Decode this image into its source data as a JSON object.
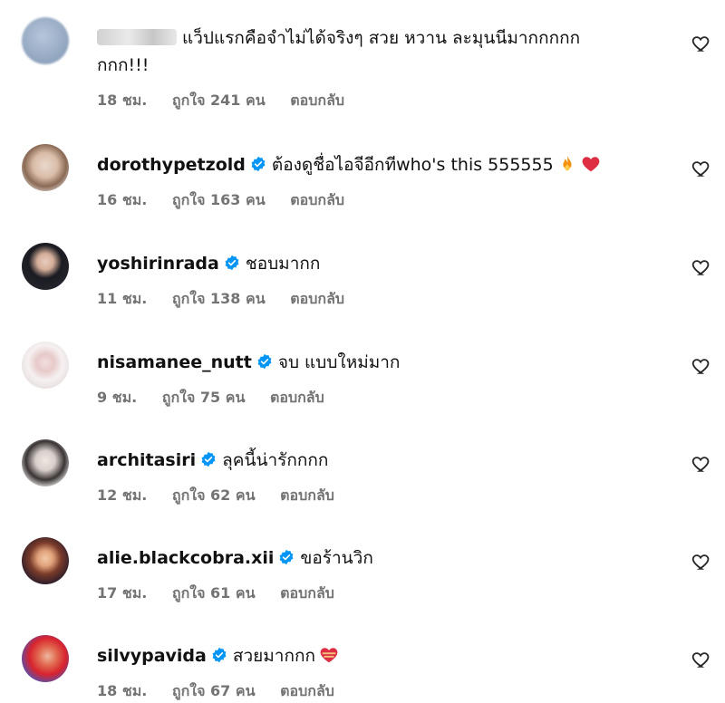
{
  "comments": [
    {
      "username": "",
      "text": "แว็ปแรกคือจำไม่ได้จริงๆ สวย หวาน ละมุนนีมากกกกก กกก!!!",
      "text_line1": "แว็ปแรกคือจำไม่ได้จริงๆ สวย หวาน ละมุนนีมากกกกก",
      "text_line2": "กกก!!!",
      "time": "18 ชม.",
      "likes": "ถูกใจ 241 คน",
      "reply": "ตอบกลับ"
    },
    {
      "username": "dorothypetzold",
      "text": "ต้องดูชื่อไอจีอีกทีwho's this 555555",
      "time": "16 ชม.",
      "likes": "ถูกใจ 163 คน",
      "reply": "ตอบกลับ"
    },
    {
      "username": "yoshirinrada",
      "text": "ชอบมากก",
      "time": "11 ชม.",
      "likes": "ถูกใจ 138 คน",
      "reply": "ตอบกลับ"
    },
    {
      "username": "nisamanee_nutt",
      "text": "จบ แบบใหม่มาก",
      "time": "9 ชม.",
      "likes": "ถูกใจ 75 คน",
      "reply": "ตอบกลับ"
    },
    {
      "username": "architasiri",
      "text": "ลุคนี้น่ารักกกก",
      "time": "12 ชม.",
      "likes": "ถูกใจ 62 คน",
      "reply": "ตอบกลับ"
    },
    {
      "username": "alie.blackcobra.xii",
      "text": "ขอร้านวิก",
      "time": "17 ชม.",
      "likes": "ถูกใจ 61 คน",
      "reply": "ตอบกลับ"
    },
    {
      "username": "silvypavida",
      "text": "สวยมากกก",
      "time": "18 ชม.",
      "likes": "ถูกใจ 67 คน",
      "reply": "ตอบกลับ"
    }
  ],
  "colors": {
    "verified": "#0095f6",
    "meta": "#737373",
    "text": "#111111"
  },
  "icons": {
    "verified": "verified-badge-icon",
    "like": "heart-outline-icon",
    "fire": "fire-emoji",
    "red_heart": "red-heart-emoji",
    "heart_bandage": "heart-on-fire-emoji"
  }
}
